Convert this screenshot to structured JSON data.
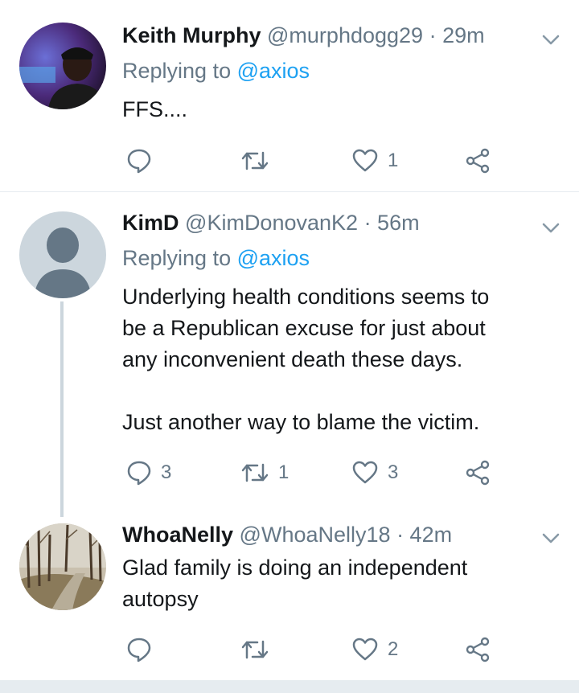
{
  "tweets": [
    {
      "name": "Keith Murphy",
      "handle": "@murphdogg29",
      "time": "· 29m",
      "replying_prefix": "Replying to",
      "replying_to": "@axios",
      "text_lines": [
        "FFS...."
      ],
      "replies": "",
      "retweets": "",
      "likes": "1"
    },
    {
      "name": "KimD",
      "handle": "@KimDonovanK2",
      "time": "· 56m",
      "replying_prefix": "Replying to",
      "replying_to": "@axios",
      "text_lines": [
        "Underlying health conditions seems to",
        "be a Republican excuse for just about",
        "any inconvenient death these days.",
        "",
        "Just another way to blame the victim."
      ],
      "replies": "3",
      "retweets": "1",
      "likes": "3"
    },
    {
      "name": "WhoaNelly",
      "handle": "@WhoaNelly18",
      "time": "· 42m",
      "text_lines": [
        "Glad family is doing an independent",
        "autopsy"
      ],
      "replies": "",
      "retweets": "",
      "likes": "2"
    }
  ],
  "icons": {
    "reply": "reply-icon",
    "retweet": "retweet-icon",
    "like": "heart-icon",
    "share": "share-icon",
    "more": "chevron-down-icon"
  },
  "colors": {
    "text": "#14171a",
    "secondary": "#657786",
    "link": "#1da1f2",
    "divider": "#e6ecf0",
    "thread_line": "#ccd6dd"
  }
}
